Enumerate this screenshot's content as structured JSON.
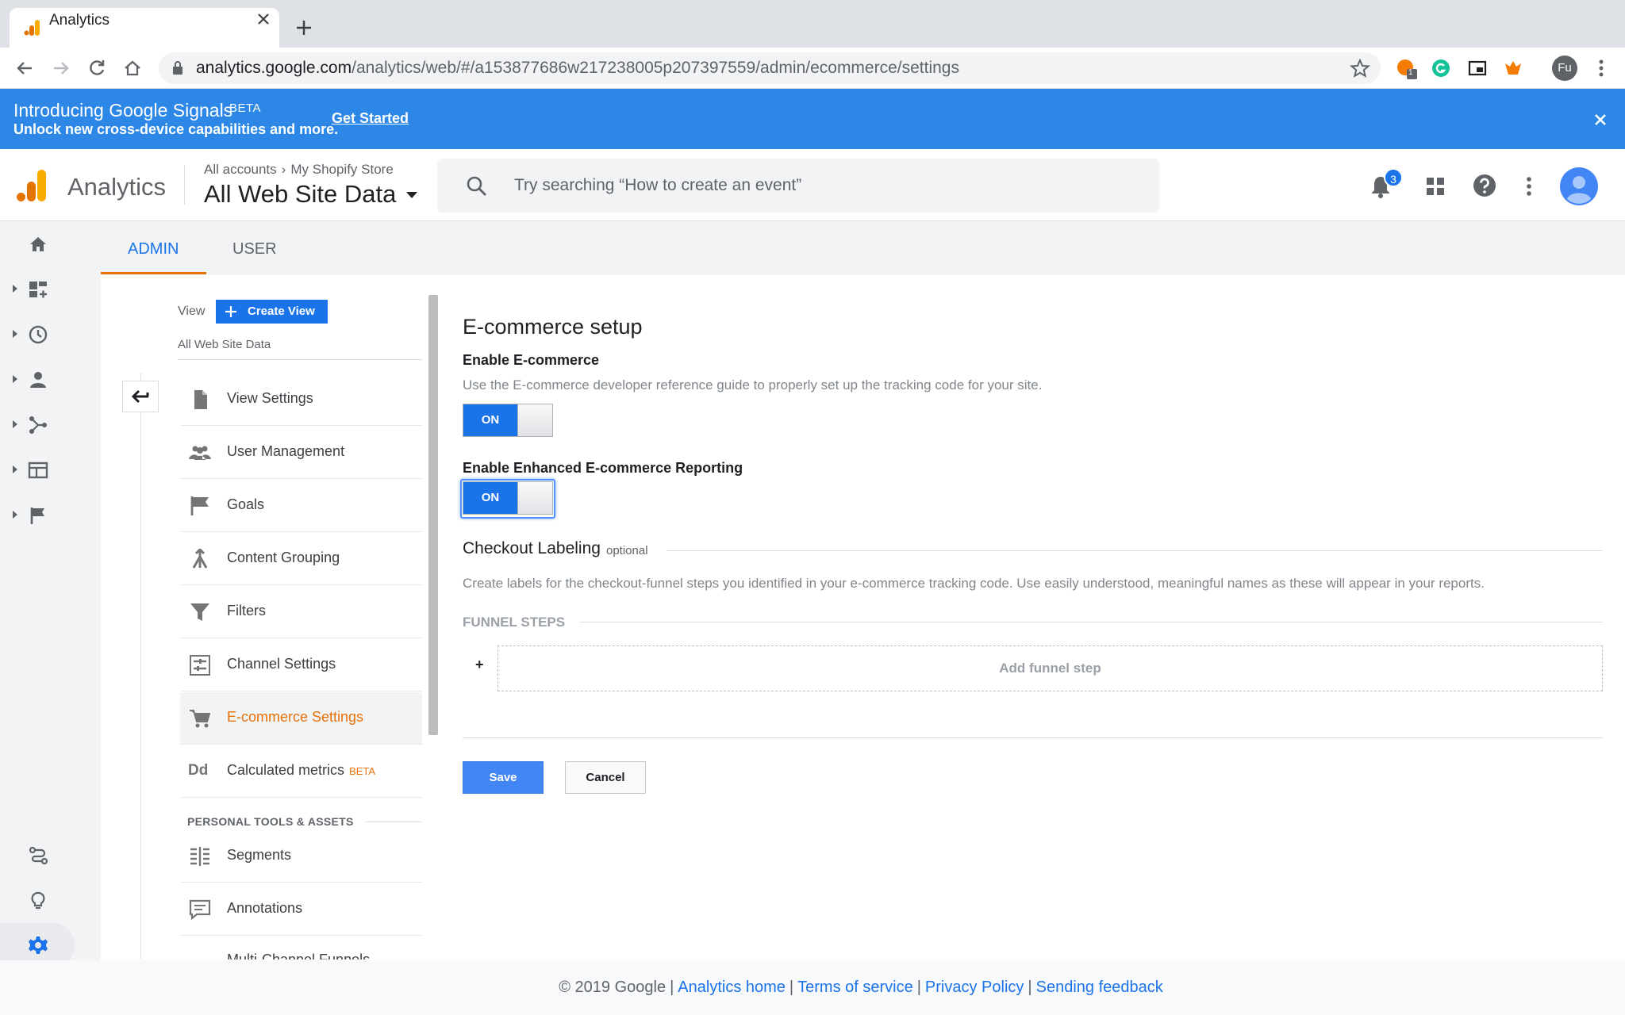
{
  "browser": {
    "tab_title": "Analytics",
    "url_host": "analytics.google.com",
    "url_path": "/analytics/web/#/a153877686w217238005p207397559/admin/ecommerce/settings",
    "extension_badge": "1",
    "profile_initials": "Fu"
  },
  "banner": {
    "title": "Introducing Google Signals",
    "beta": "BETA",
    "subtitle": "Unlock new cross-device capabilities and more.",
    "link": "Get Started"
  },
  "header": {
    "app_name": "Analytics",
    "crumb_accounts": "All accounts",
    "crumb_sep": "›",
    "crumb_property": "My Shopify Store",
    "view_name": "All Web Site Data",
    "search_placeholder": "Try searching “How to create an event”",
    "notification_count": "3"
  },
  "tabs": {
    "admin": "ADMIN",
    "user": "USER"
  },
  "admin_column": {
    "view_label": "View",
    "create_view": "Create View",
    "view_data": "All Web Site Data",
    "items": [
      {
        "label": "View Settings",
        "icon": "document-icon"
      },
      {
        "label": "User Management",
        "icon": "people-icon"
      },
      {
        "label": "Goals",
        "icon": "flag-icon"
      },
      {
        "label": "Content Grouping",
        "icon": "content-grouping-icon"
      },
      {
        "label": "Filters",
        "icon": "filter-icon"
      },
      {
        "label": "Channel Settings",
        "icon": "channel-settings-icon"
      },
      {
        "label": "E-commerce Settings",
        "icon": "cart-icon"
      },
      {
        "label": "Calculated metrics",
        "icon": "calculated-metrics-icon",
        "badge": "BETA"
      }
    ],
    "personal_title": "PERSONAL TOOLS & ASSETS",
    "personal_items": [
      {
        "label": "Segments",
        "icon": "segments-icon"
      },
      {
        "label": "Annotations",
        "icon": "annotations-icon"
      }
    ],
    "partial_item": "Multi-Channel Funnels"
  },
  "ecommerce": {
    "title": "E-commerce setup",
    "enable_label": "Enable E-commerce",
    "enable_desc": "Use the E-commerce developer reference guide to properly set up the tracking code for your site.",
    "enable_state": "ON",
    "enhanced_label": "Enable Enhanced E-commerce Reporting",
    "enhanced_state": "ON",
    "checkout_title": "Checkout Labeling",
    "checkout_optional": "optional",
    "checkout_desc": "Create labels for the checkout-funnel steps you identified in your e-commerce tracking code. Use easily understood, meaningful names as these will appear in your reports.",
    "funnel_title": "FUNNEL STEPS",
    "funnel_plus": "+",
    "add_step": "Add funnel step",
    "save": "Save",
    "cancel": "Cancel"
  },
  "footer": {
    "copyright": "© 2019 Google",
    "sep": "|",
    "links": [
      "Analytics home",
      "Terms of service",
      "Privacy Policy",
      "Sending feedback"
    ]
  },
  "colors": {
    "brand_orange": "#e8710a",
    "primary_blue": "#1a73e8",
    "banner_blue": "#2c87e6"
  }
}
